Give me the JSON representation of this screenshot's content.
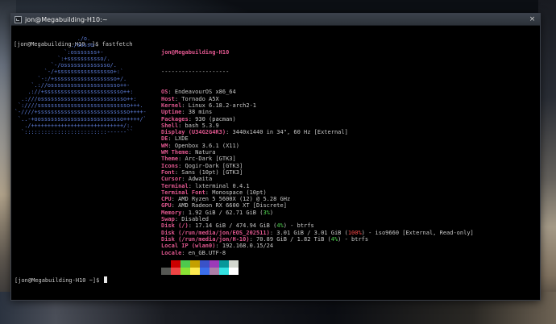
{
  "window": {
    "title": "jon@Megabuilding-H10:~",
    "close_icon": "×"
  },
  "terminal": {
    "command_line": "[jon@Megabuilding-H10 ~]$ fastfetch",
    "bottom_prompt": "[jon@Megabuilding-H10 ~]$ "
  },
  "logo_lines": [
    "                   ./o.",
    "                 ./sssso-",
    "               `:osssssss+-",
    "             `:+sssssssssso/.",
    "           `-/ossssssssssssso/.",
    "         `-/+sssssssssssssssso+:`",
    "       `-:/+sssssssssssssssssso+/.",
    "     `.://osssssssssssssssssssso++-",
    "    .://+ssssssssssssssssssssssso++:",
    "  .:///ossssssssssssssssssssssssso++:",
    " `:////ssssssssssssssssssssssssssso+++.",
    "`-////+ssssssssssssssssssssssssssso++++-",
    " `..-+oosssssssssssssssssssssssso+++++/`",
    "   ./++++++++++++++++++++++++++++/:.",
    "  `:::::::::::::::::::::::::------``"
  ],
  "info": {
    "user_host": "jon@Megabuilding-H10",
    "separator": "--------------------",
    "rows": [
      {
        "key": "OS",
        "value": "EndeavourOS x86_64"
      },
      {
        "key": "Host",
        "value": "Tornado A5X"
      },
      {
        "key": "Kernel",
        "value": "Linux 6.18.2-arch2-1"
      },
      {
        "key": "Uptime",
        "value": "38 mins"
      },
      {
        "key": "Packages",
        "value": "930 (pacman)"
      },
      {
        "key": "Shell",
        "value": "bash 5.3.9"
      },
      {
        "key": "Display (U34G2G4R3)",
        "value": "3440x1440 in 34\", 60 Hz [External]"
      },
      {
        "key": "DE",
        "value": "LXDE"
      },
      {
        "key": "WM",
        "value": "Openbox 3.6.1 (X11)"
      },
      {
        "key": "WM Theme",
        "value": "Natura"
      },
      {
        "key": "Theme",
        "value": "Arc-Dark [GTK3]"
      },
      {
        "key": "Icons",
        "value": "Qogir-Dark [GTK3]"
      },
      {
        "key": "Font",
        "value": "Sans (10pt) [GTK3]"
      },
      {
        "key": "Cursor",
        "value": "Adwaita"
      },
      {
        "key": "Terminal",
        "value": "lxterminal 0.4.1"
      },
      {
        "key": "Terminal Font",
        "value": "Monospace (10pt)"
      },
      {
        "key": "CPU",
        "value": "AMD Ryzen 5 5600X (12) @ 5.28 GHz"
      },
      {
        "key": "GPU",
        "value": "AMD Radeon RX 6600 XT [Discrete]"
      },
      {
        "key": "Memory",
        "value_pre": "1.92 GiB / 62.71 GiB (",
        "pct": "3%",
        "pct_color": "green",
        "value_post": ")"
      },
      {
        "key": "Swap",
        "value": "Disabled"
      },
      {
        "key": "Disk (/)",
        "value_pre": "17.14 GiB / 474.94 GiB (",
        "pct": "4%",
        "pct_color": "green",
        "value_post": ") - btrfs"
      },
      {
        "key": "Disk (/run/media/jon/EOS_202511)",
        "value_pre": "3.01 GiB / 3.01 GiB (",
        "pct": "100%",
        "pct_color": "red",
        "value_post": ") - iso9660 [External, Read-only]"
      },
      {
        "key": "Disk (/run/media/jon/H-10)",
        "value_pre": "70.89 GiB / 1.82 TiB (",
        "pct": "4%",
        "pct_color": "green",
        "value_post": ") - btrfs"
      },
      {
        "key": "Local IP (wlan0)",
        "value": "192.168.0.15/24"
      },
      {
        "key": "Locale",
        "value": "en_GB.UTF-8"
      }
    ]
  },
  "palette": {
    "row1": [
      "#000000",
      "#cc0000",
      "#4ec94e",
      "#c4a000",
      "#3a52c8",
      "#9c3bb8",
      "#06989a",
      "#d3d7cf"
    ],
    "row2": [
      "#555753",
      "#ef4444",
      "#8ae234",
      "#fce94f",
      "#3b6eea",
      "#ad7fa8",
      "#34e2e2",
      "#ffffff"
    ]
  }
}
